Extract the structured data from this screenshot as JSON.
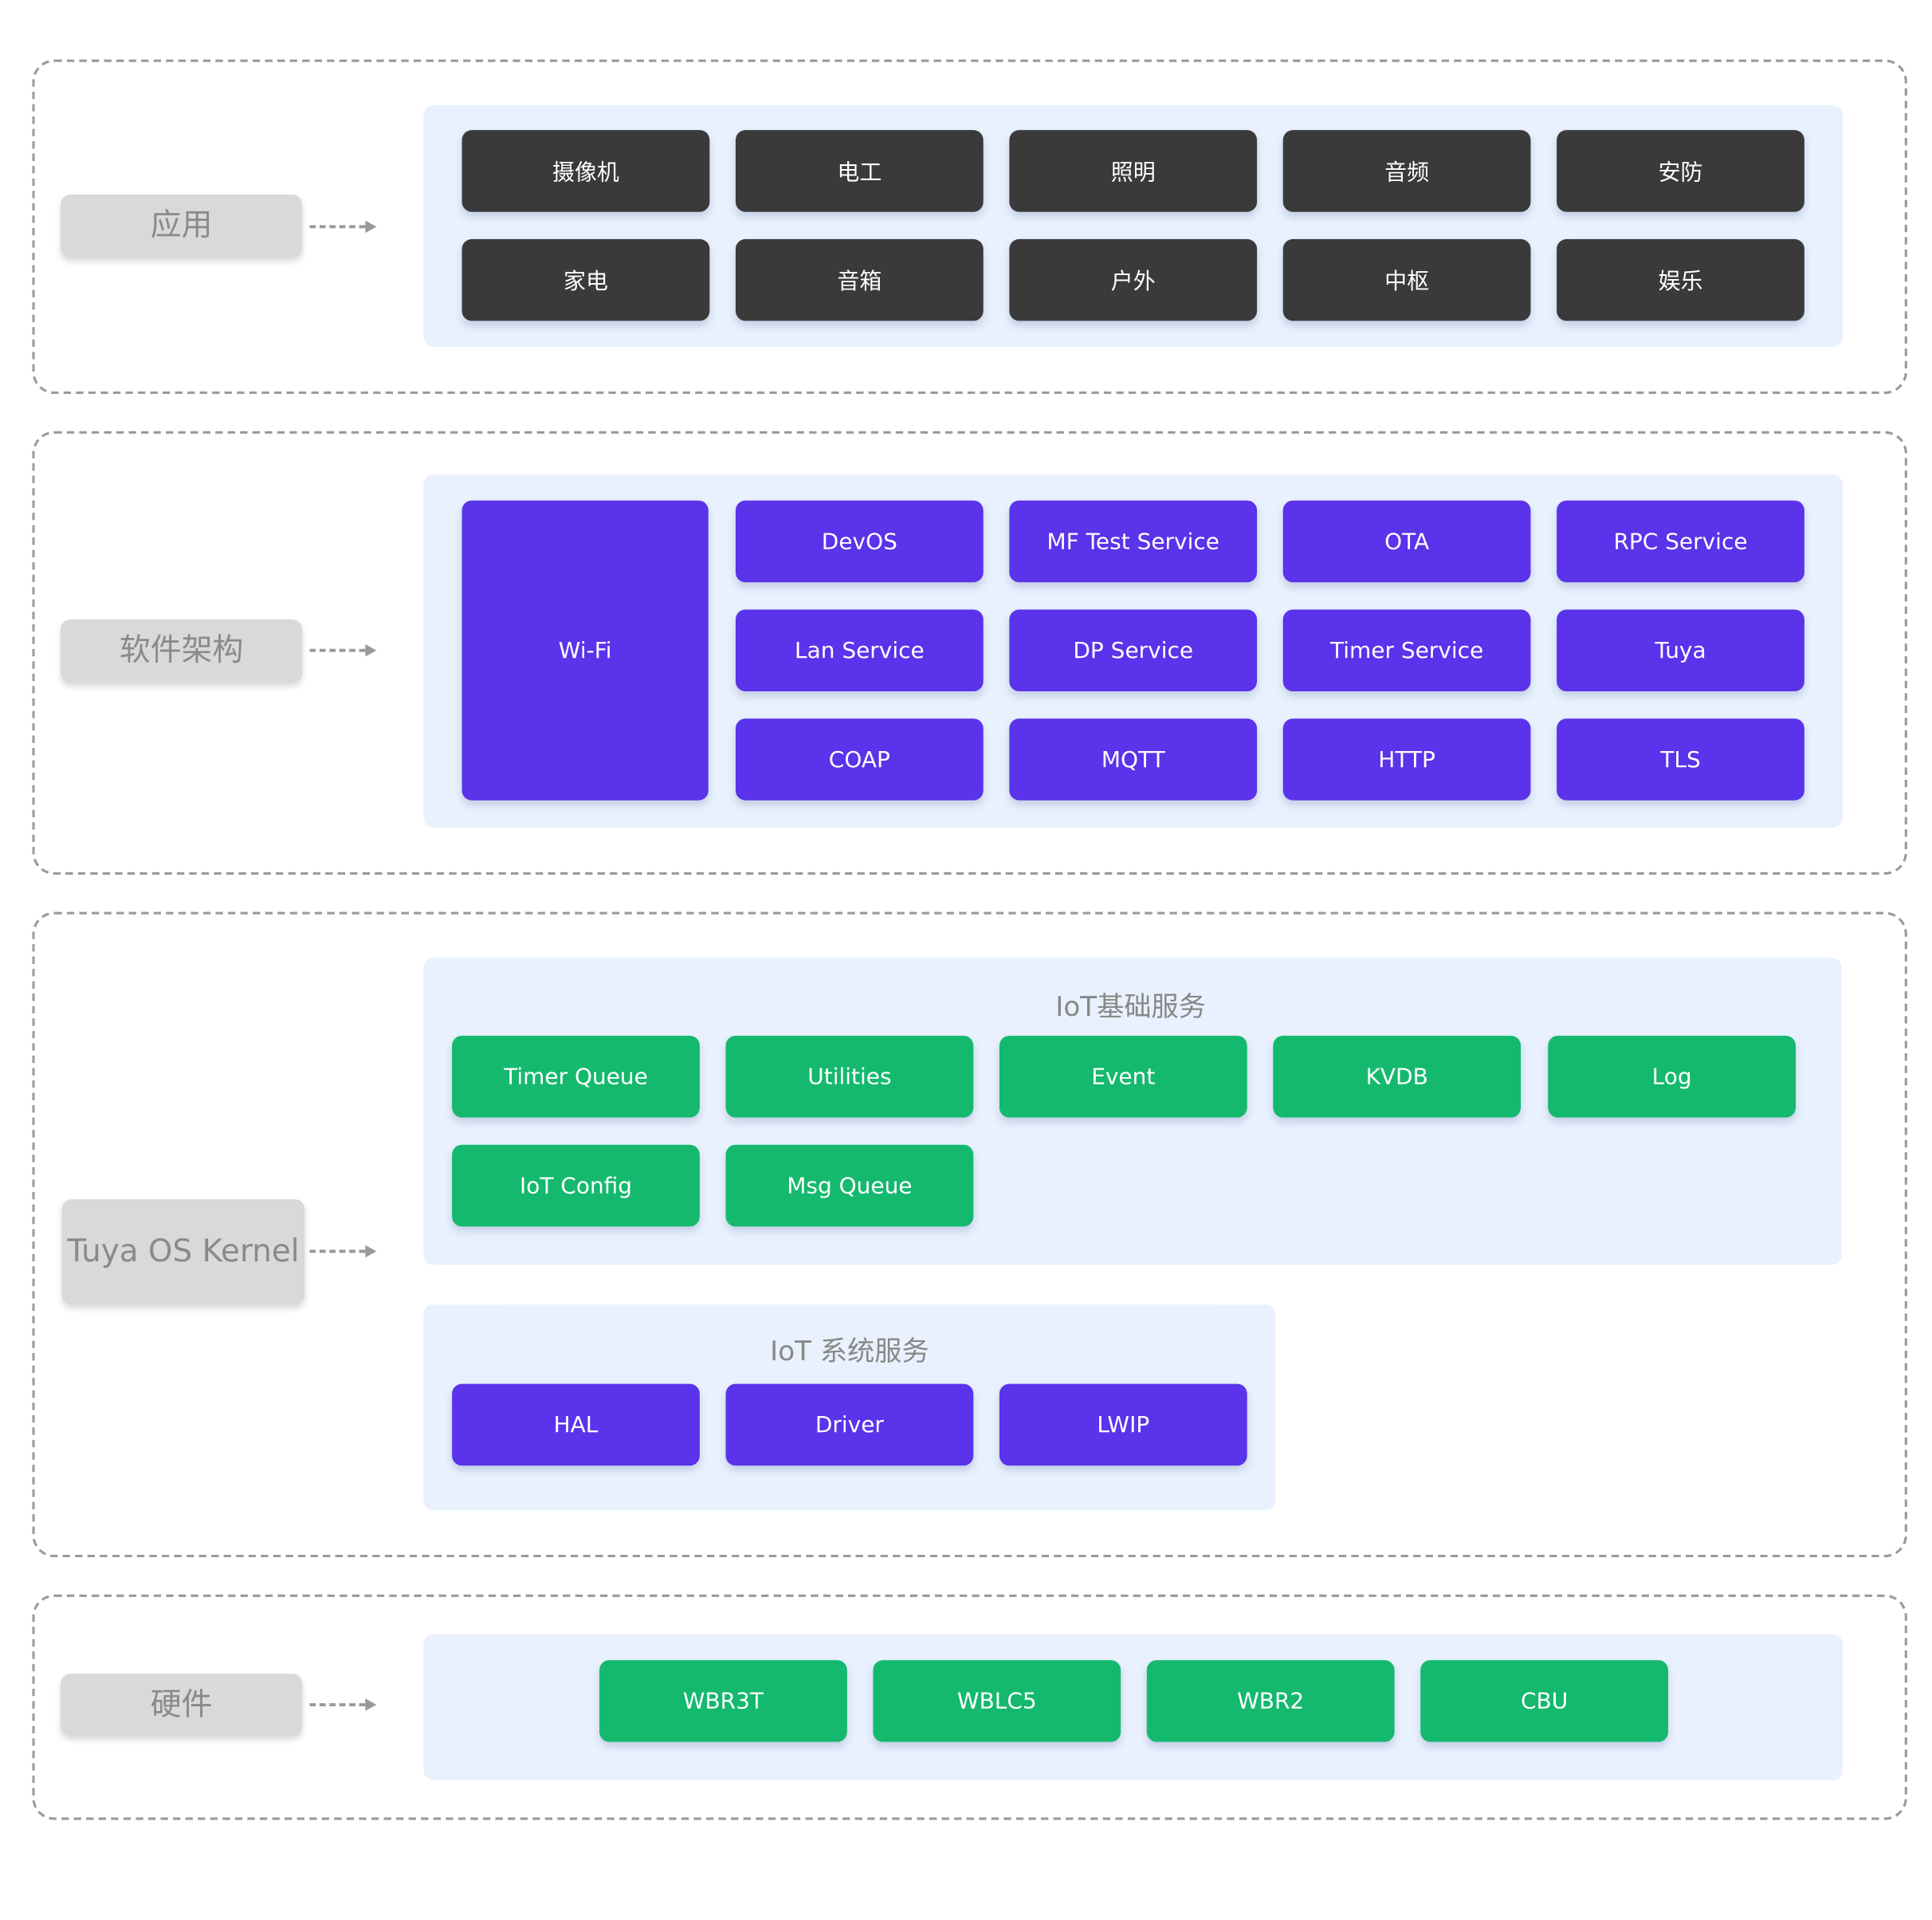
{
  "colors": {
    "app": "#3a3a3a",
    "software": "#5a33ea",
    "kernel_green": "#14b96e",
    "panel": "#e8f1fd",
    "label_bg": "#d9d9d9"
  },
  "sections": {
    "app": {
      "label": "应用",
      "items": [
        "摄像机",
        "电工",
        "照明",
        "音频",
        "安防",
        "家电",
        "音箱",
        "户外",
        "中枢",
        "娱乐"
      ]
    },
    "software": {
      "label": "软件架构",
      "wifi": "Wi-Fi",
      "items": [
        "DevOS",
        "MF Test Service",
        "OTA",
        "RPC Service",
        "Lan Service",
        "DP Service",
        "Timer Service",
        "Tuya",
        "COAP",
        "MQTT",
        "HTTP",
        "TLS"
      ]
    },
    "kernel": {
      "label": "Tuya OS Kernel",
      "basic": {
        "title": "IoT基础服务",
        "items": [
          "Timer Queue",
          "Utilities",
          "Event",
          "KVDB",
          "Log",
          "IoT Config",
          "Msg Queue"
        ]
      },
      "system": {
        "title": "IoT 系统服务",
        "items": [
          "HAL",
          "Driver",
          "LWIP"
        ]
      }
    },
    "hardware": {
      "label": "硬件",
      "items": [
        "WBR3T",
        "WBLC5",
        "WBR2",
        "CBU"
      ]
    }
  }
}
